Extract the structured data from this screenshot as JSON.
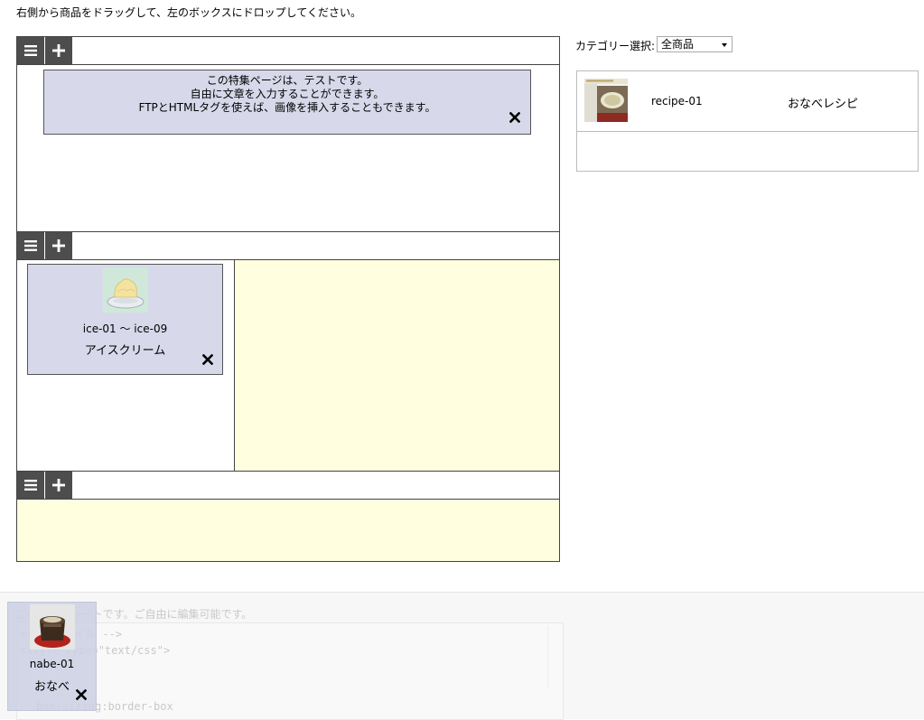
{
  "instruction": "右側から商品をドラッグして、左のボックスにドロップしてください。",
  "editor": {
    "sections": [
      {
        "toolbar": {
          "menu_icon": "menu-icon",
          "add_icon": "plus-icon"
        },
        "text_block": {
          "lines": [
            "この特集ページは、テストです。",
            "自由に文章を入力することができます。",
            "FTPとHTMLタグを使えば、画像を挿入することもできます。"
          ],
          "close_icon": "close-icon"
        }
      },
      {
        "toolbar": {
          "menu_icon": "menu-icon",
          "add_icon": "plus-icon"
        },
        "product_card": {
          "code": "ice-01 〜 ice-09",
          "name": "アイスクリーム",
          "image_icon": "ice-cream-thumbnail",
          "close_icon": "close-icon"
        },
        "empty_zone_color": "#fffedf"
      },
      {
        "toolbar": {
          "menu_icon": "menu-icon",
          "add_icon": "plus-icon"
        },
        "empty_zone_color": "#fffedf"
      }
    ]
  },
  "category": {
    "label": "カテゴリー選択:",
    "selected": "全商品"
  },
  "product_list": [
    {
      "code": "recipe-01",
      "name": "おなべレシピ",
      "image_icon": "recipe-thumbnail"
    }
  ],
  "template_editor": {
    "notice": "このテンプレートです。ご自由に編集可能です。",
    "code_lines": [
      "<!-- スタイル -->",
      "<style type=\"text/css\">",
      "",
      "",
      "  box-sizing:border-box"
    ]
  },
  "dragging_item": {
    "code": "nabe-01",
    "name": "おなべ",
    "image_icon": "nabe-thumbnail",
    "close_icon": "close-icon"
  },
  "colors": {
    "toolbar_button": "#4d4d4d",
    "card_background": "#d7d9ea",
    "drop_zone": "#fffedf"
  }
}
